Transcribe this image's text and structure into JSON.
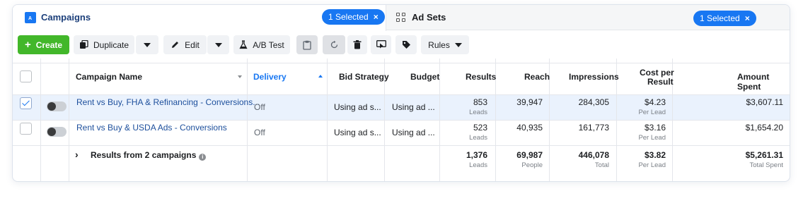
{
  "tabs": {
    "campaigns": {
      "label": "Campaigns",
      "icon": "campaign-icon",
      "selected_badge": "1 Selected",
      "close": "×"
    },
    "adsets": {
      "label": "Ad Sets",
      "icon": "grid-icon",
      "selected_badge": "1 Selected",
      "close": "×"
    }
  },
  "toolbar": {
    "create_label": "Create",
    "create_plus": "+",
    "duplicate_label": "Duplicate",
    "edit_label": "Edit",
    "abtest_label": "A/B Test",
    "rules_label": "Rules"
  },
  "table": {
    "headers": {
      "name": "Campaign Name",
      "delivery": "Delivery",
      "bid": "Bid Strategy",
      "budget": "Budget",
      "results": "Results",
      "reach": "Reach",
      "impressions": "Impressions",
      "cpr_1": "Cost per",
      "cpr_2": "Result",
      "spent": "Amount Spent"
    },
    "rows": [
      {
        "selected": true,
        "name": "Rent vs Buy, FHA & Refinancing - Conversions...",
        "delivery": "Off",
        "bid": "Using ad s...",
        "budget": "Using ad ...",
        "results": "853",
        "results_sub": "Leads",
        "reach": "39,947",
        "impressions": "284,305",
        "cpr": "$4.23",
        "cpr_sub": "Per Lead",
        "spent": "$3,607.11"
      },
      {
        "selected": false,
        "name": "Rent vs Buy & USDA Ads - Conversions",
        "delivery": "Off",
        "bid": "Using ad s...",
        "budget": "Using ad ...",
        "results": "523",
        "results_sub": "Leads",
        "reach": "40,935",
        "impressions": "161,773",
        "cpr": "$3.16",
        "cpr_sub": "Per Lead",
        "spent": "$1,654.20"
      }
    ],
    "totals": {
      "label": "Results from 2 campaigns",
      "expand": "›",
      "info": "i",
      "results": "1,376",
      "results_sub": "Leads",
      "reach": "69,987",
      "reach_sub": "People",
      "impressions": "446,078",
      "impressions_sub": "Total",
      "cpr": "$3.82",
      "cpr_sub": "Per Lead",
      "spent": "$5,261.31",
      "spent_sub": "Total Spent"
    }
  },
  "colors": {
    "brand_blue": "#1877f2",
    "create_green": "#42b72a",
    "selected_row": "#eaf2fd"
  }
}
